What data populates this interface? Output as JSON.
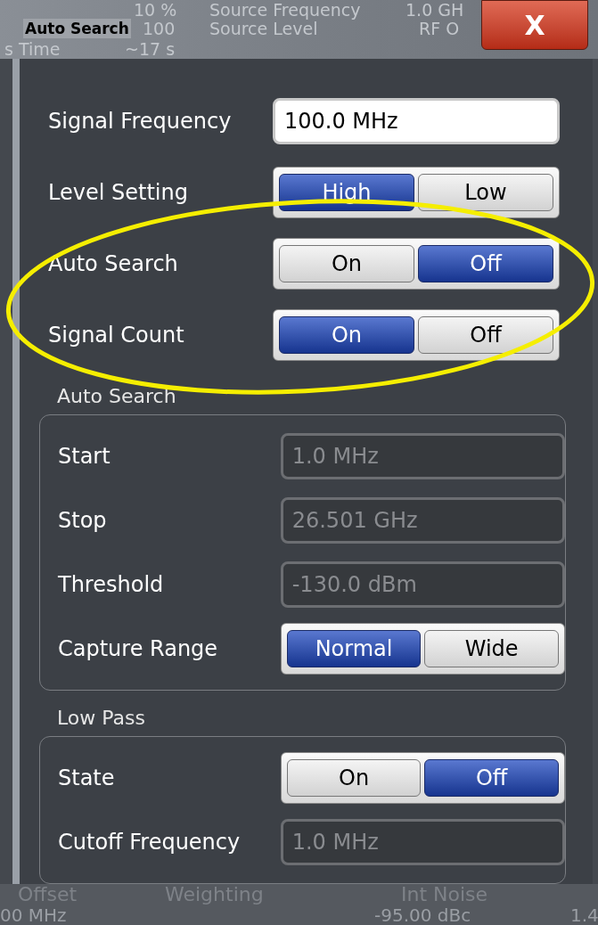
{
  "background": {
    "top_rows": [
      [
        "10 %",
        "Source Frequency",
        "1.0 GH"
      ],
      [
        "100",
        "Source Level",
        "RF O"
      ],
      [
        "s Time",
        "~17 s"
      ]
    ],
    "bottom_header": [
      "Offset",
      "Weighting",
      "Int Noise"
    ],
    "bottom_row": [
      "00 MHz",
      "-95.00 dBc",
      "1.4"
    ]
  },
  "dialog": {
    "title": "Auto Search",
    "close": "X",
    "rows": [
      {
        "kind": "field",
        "label": "Signal Frequency",
        "value": "100.0 MHz",
        "disabled": false
      },
      {
        "kind": "toggle",
        "label": "Level Setting",
        "options": [
          {
            "label": "High",
            "selected": true
          },
          {
            "label": "Low",
            "selected": false
          }
        ]
      },
      {
        "kind": "toggle",
        "label": "Auto Search",
        "options": [
          {
            "label": "On",
            "selected": false
          },
          {
            "label": "Off",
            "selected": true
          }
        ]
      },
      {
        "kind": "toggle",
        "label": "Signal Count",
        "options": [
          {
            "label": "On",
            "selected": true
          },
          {
            "label": "Off",
            "selected": false
          }
        ]
      }
    ],
    "groups": [
      {
        "title": "Auto Search",
        "rows": [
          {
            "kind": "field",
            "label": "Start",
            "value": "1.0 MHz",
            "disabled": true
          },
          {
            "kind": "field",
            "label": "Stop",
            "value": "26.501 GHz",
            "disabled": true
          },
          {
            "kind": "field",
            "label": "Threshold",
            "value": "-130.0 dBm",
            "disabled": true
          },
          {
            "kind": "toggle",
            "label": "Capture Range",
            "options": [
              {
                "label": "Normal",
                "selected": true
              },
              {
                "label": "Wide",
                "selected": false
              }
            ]
          }
        ]
      },
      {
        "title": "Low Pass",
        "rows": [
          {
            "kind": "toggle",
            "label": "State",
            "options": [
              {
                "label": "On",
                "selected": false
              },
              {
                "label": "Off",
                "selected": true
              }
            ]
          },
          {
            "kind": "field",
            "label": "Cutoff Frequency",
            "value": "1.0 MHz",
            "disabled": true
          }
        ]
      }
    ]
  },
  "annotation": {
    "kind": "ellipse",
    "color": "#f5ee00"
  }
}
